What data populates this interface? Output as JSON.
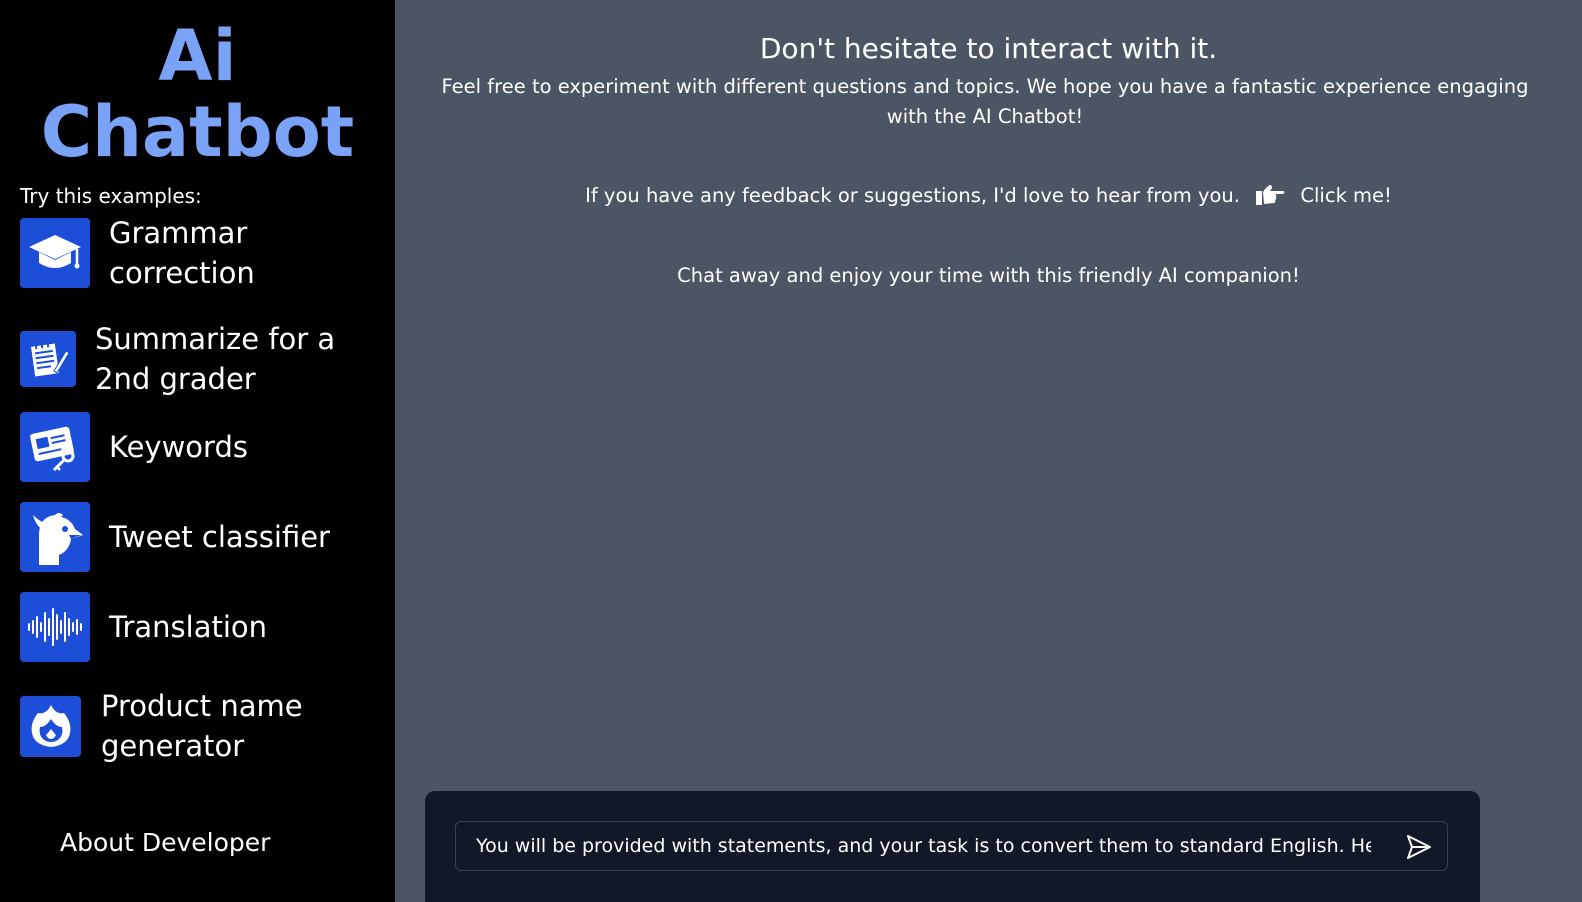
{
  "sidebar": {
    "brand_line1": "Ai",
    "brand_line2": "Chatbot",
    "examples_label": "Try this examples:",
    "examples": [
      {
        "label": "Grammar correction",
        "icon": "graduation-cap-icon"
      },
      {
        "label": "Summarize for a 2nd grader",
        "icon": "notepad-icon"
      },
      {
        "label": "Keywords",
        "icon": "keyword-card-icon"
      },
      {
        "label": "Tweet classifier",
        "icon": "bird-icon"
      },
      {
        "label": "Translation",
        "icon": "sound-wave-icon"
      },
      {
        "label": "Product name generator",
        "icon": "flame-icon"
      }
    ],
    "about_label": "About Developer"
  },
  "main": {
    "headline": "Don't hesitate to interact with it.",
    "intro": "Feel free to experiment with different questions and topics. We hope you have a fantastic experience engaging with the AI Chatbot!",
    "feedback_text": "If you have any feedback or suggestions, I'd love to hear from you.",
    "feedback_link": "Click me!",
    "enjoy_text": "Chat away and enjoy your time with this friendly AI companion!"
  },
  "chat": {
    "input_value": "You will be provided with statements, and your task is to convert them to standard English. Here is th",
    "send_icon": "send-icon"
  },
  "colors": {
    "sidebar_bg": "#000000",
    "main_bg": "#4b5563",
    "brand": "#7aa2f7",
    "icon_bg": "#1d4ed8",
    "chat_panel_bg": "#111827"
  }
}
